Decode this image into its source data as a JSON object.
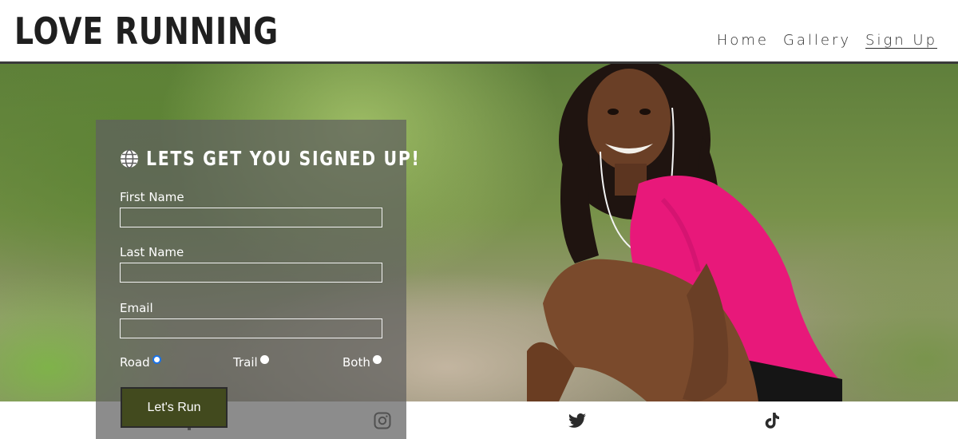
{
  "header": {
    "logo": "LOVE RUNNING",
    "nav": [
      {
        "label": "Home"
      },
      {
        "label": "Gallery"
      },
      {
        "label": "Sign Up",
        "active": true
      }
    ]
  },
  "signup": {
    "title": "LETS GET YOU SIGNED UP!",
    "title_icon": "globe-icon",
    "fields": [
      {
        "label": "First Name",
        "value": ""
      },
      {
        "label": "Last Name",
        "value": ""
      },
      {
        "label": "Email",
        "value": ""
      }
    ],
    "radio_options": [
      {
        "label": "Road",
        "checked": true
      },
      {
        "label": "Trail",
        "checked": false
      },
      {
        "label": "Both",
        "checked": false
      }
    ],
    "submit_label": "Let's Run"
  },
  "footer": {
    "social": [
      "facebook-icon",
      "instagram-icon",
      "twitter-icon",
      "tiktok-icon"
    ]
  },
  "colors": {
    "header_border": "#3a3a3a",
    "button_bg": "#424a1e",
    "shirt_pink": "#e8187a",
    "radio_checked": "#1a73e8"
  }
}
